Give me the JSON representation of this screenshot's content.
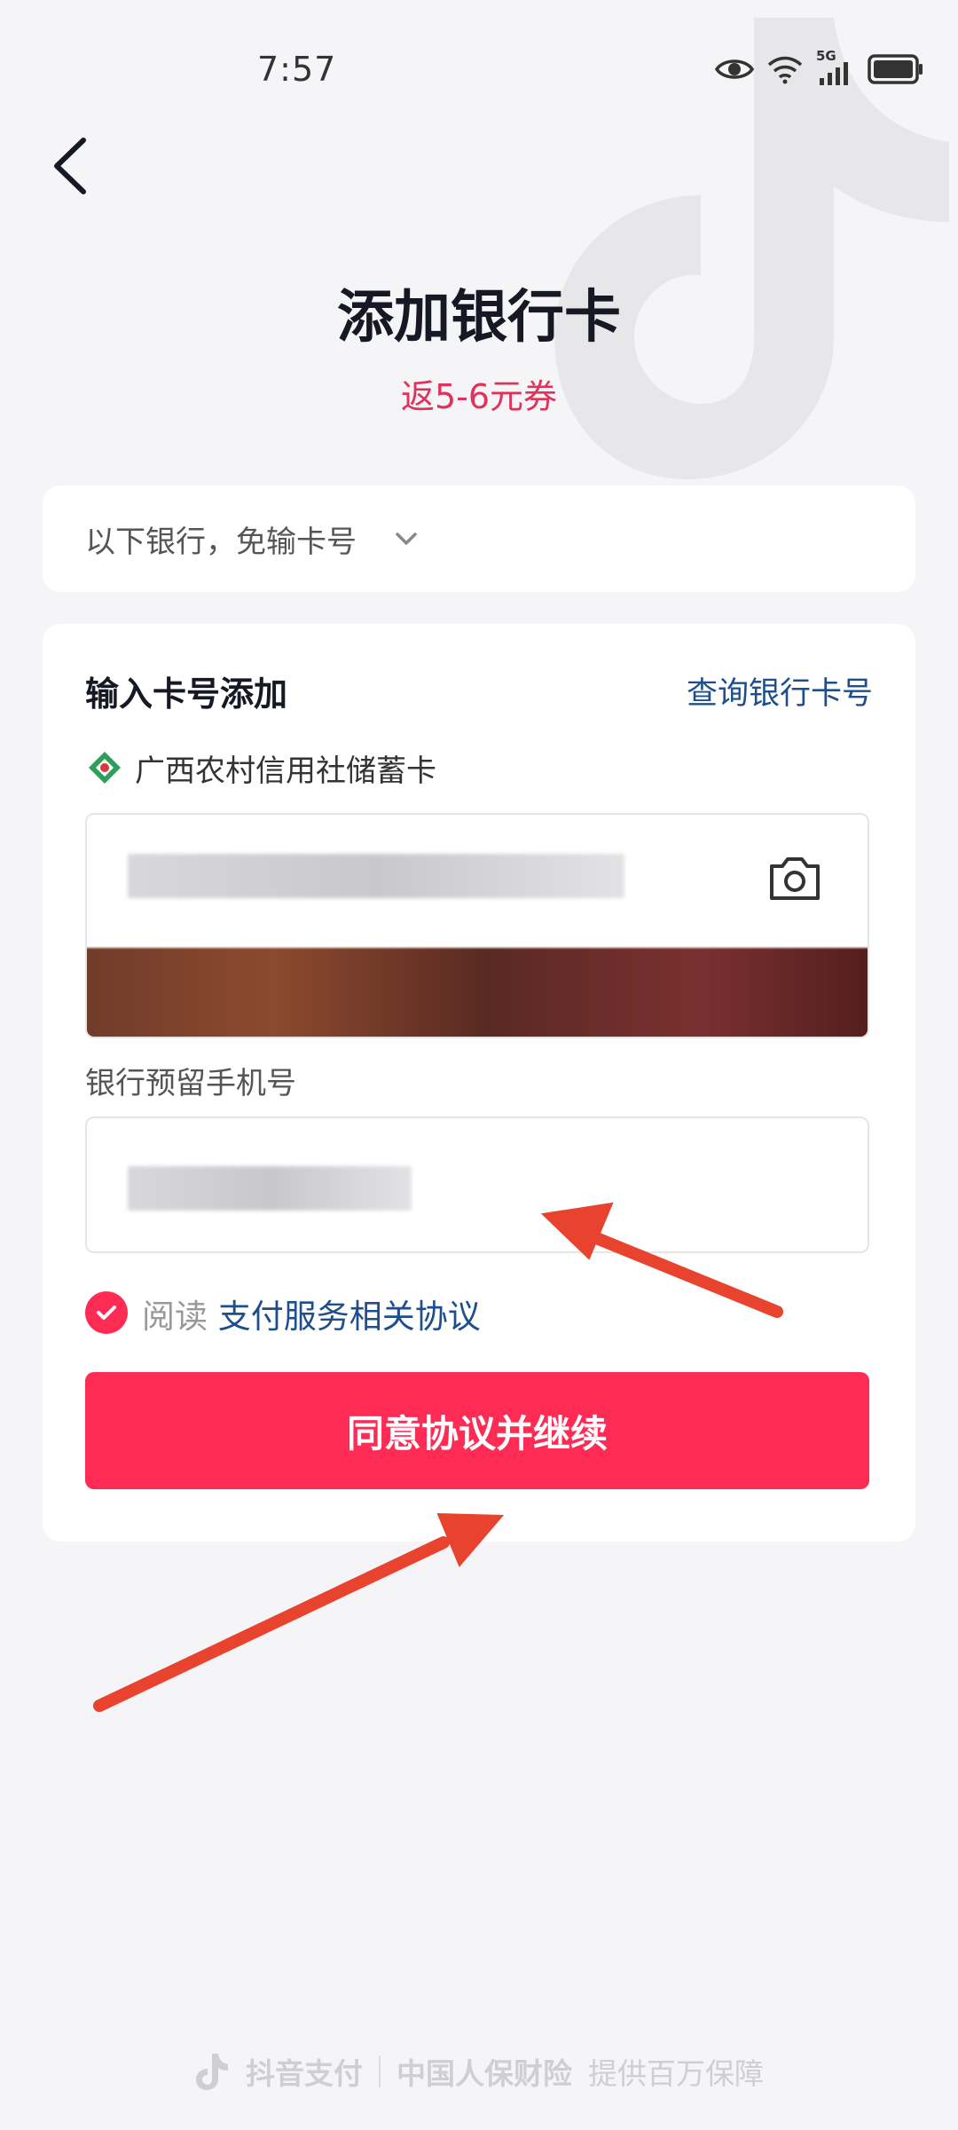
{
  "status": {
    "time": "7:57",
    "network": "5G"
  },
  "header": {
    "title": "添加银行卡",
    "subtitle": "返5-6元券"
  },
  "bank_select": {
    "label": "以下银行，免输卡号"
  },
  "form": {
    "section_title": "输入卡号添加",
    "lookup_link": "查询银行卡号",
    "bank_name": "广西农村信用社储蓄卡",
    "phone_label": "银行预留手机号",
    "agree_prefix": "阅读",
    "agree_link": "支付服务相关协议",
    "continue_button": "同意协议并继续"
  },
  "footer": {
    "brand": "抖音支付",
    "partner": "中国人保财险",
    "tagline": "提供百万保障"
  },
  "colors": {
    "accent": "#fe2c55",
    "link": "#1e4f8c",
    "subtitle": "#e0335b",
    "annotation_arrow": "#e8432e"
  }
}
